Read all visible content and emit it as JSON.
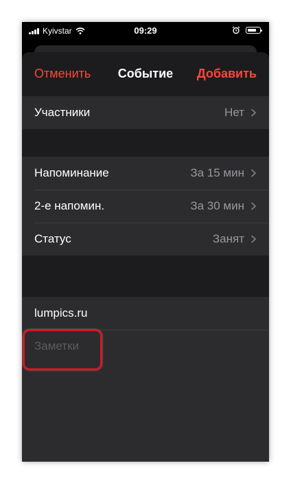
{
  "status_bar": {
    "carrier": "Kyivstar",
    "time": "09:29"
  },
  "nav": {
    "cancel": "Отменить",
    "title": "Событие",
    "add": "Добавить"
  },
  "rows_top": [
    {
      "label": "Участники",
      "value": "Нет"
    }
  ],
  "rows_alerts": [
    {
      "label": "Напоминание",
      "value": "За 15 мин"
    },
    {
      "label": "2-е напомин.",
      "value": "За 30 мин"
    },
    {
      "label": "Статус",
      "value": "Занят"
    }
  ],
  "url": {
    "value": "lumpics.ru"
  },
  "notes": {
    "placeholder": "Заметки"
  },
  "colors": {
    "accent": "#ff453a",
    "sheet_bg": "#1c1c1e",
    "cell_bg": "#2c2c2e",
    "highlight": "#d21a23"
  }
}
